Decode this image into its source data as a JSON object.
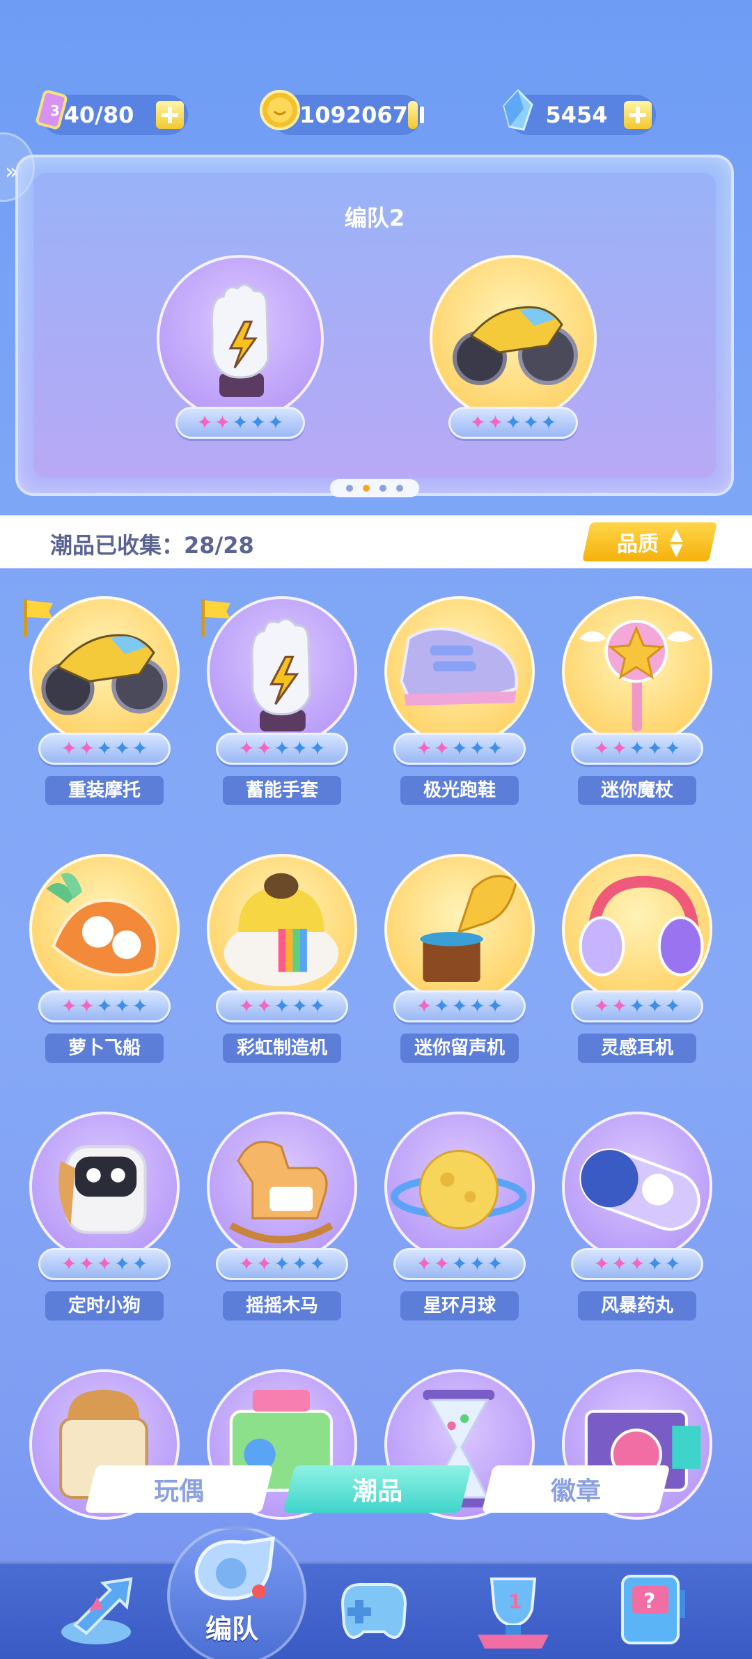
{
  "resources": [
    {
      "name": "stamina",
      "value": "40/80",
      "icon": "ticket-icon"
    },
    {
      "name": "coins",
      "value": "1092067",
      "icon": "coin-icon"
    },
    {
      "name": "gems",
      "value": "5454",
      "icon": "crystal-icon"
    }
  ],
  "team": {
    "title": "编队2",
    "slots": [
      {
        "item": "glove",
        "stars": 2,
        "bg": "purple"
      },
      {
        "item": "motorcycle",
        "stars": 2,
        "bg": "yellow"
      }
    ],
    "page_count": 4,
    "active_page": 2
  },
  "collection": {
    "label": "潮品已收集：28/28",
    "sort_label": "品质"
  },
  "items": [
    {
      "name": "重装摩托",
      "stars": 2,
      "bg": "yellow",
      "icon": "motorcycle-icon",
      "flag": true
    },
    {
      "name": "蓄能手套",
      "stars": 2,
      "bg": "purple",
      "icon": "glove-icon",
      "flag": true
    },
    {
      "name": "极光跑鞋",
      "stars": 2,
      "bg": "yellow",
      "icon": "sneaker-icon",
      "flag": false
    },
    {
      "name": "迷你魔杖",
      "stars": 2,
      "bg": "yellow",
      "icon": "wand-icon",
      "flag": false
    },
    {
      "name": "萝卜飞船",
      "stars": 2,
      "bg": "yellow",
      "icon": "carrot-ship-icon",
      "flag": false
    },
    {
      "name": "彩虹制造机",
      "stars": 2,
      "bg": "yellow",
      "icon": "rainbow-machine-icon",
      "flag": false
    },
    {
      "name": "迷你留声机",
      "stars": 1,
      "bg": "yellow",
      "icon": "gramophone-icon",
      "flag": false
    },
    {
      "name": "灵感耳机",
      "stars": 2,
      "bg": "yellow",
      "icon": "headphones-icon",
      "flag": false
    },
    {
      "name": "定时小狗",
      "stars": 3,
      "bg": "purple",
      "icon": "timer-dog-icon",
      "flag": false
    },
    {
      "name": "摇摇木马",
      "stars": 2,
      "bg": "purple",
      "icon": "rocking-horse-icon",
      "flag": false
    },
    {
      "name": "星环月球",
      "stars": 2,
      "bg": "purple",
      "icon": "ringed-moon-icon",
      "flag": false
    },
    {
      "name": "风暴药丸",
      "stars": 3,
      "bg": "purple",
      "icon": "pill-icon",
      "flag": false
    },
    {
      "name": "",
      "stars": 0,
      "bg": "purple",
      "icon": "toast-icon",
      "flag": false
    },
    {
      "name": "",
      "stars": 0,
      "bg": "purple",
      "icon": "radio-icon",
      "flag": false
    },
    {
      "name": "",
      "stars": 0,
      "bg": "purple",
      "icon": "hourglass-icon",
      "flag": false
    },
    {
      "name": "",
      "stars": 0,
      "bg": "purple",
      "icon": "camera-icon",
      "flag": false
    }
  ],
  "tabs": [
    {
      "label": "玩偶",
      "active": false
    },
    {
      "label": "潮品",
      "active": true
    },
    {
      "label": "徽章",
      "active": false
    }
  ],
  "bottom_nav": [
    {
      "icon": "arrow-icon",
      "label": ""
    },
    {
      "icon": "whistle-icon",
      "label": "编队",
      "active": true
    },
    {
      "icon": "gamepad-icon",
      "label": ""
    },
    {
      "icon": "trophy-icon",
      "label": ""
    },
    {
      "icon": "slot-machine-icon",
      "label": ""
    }
  ]
}
